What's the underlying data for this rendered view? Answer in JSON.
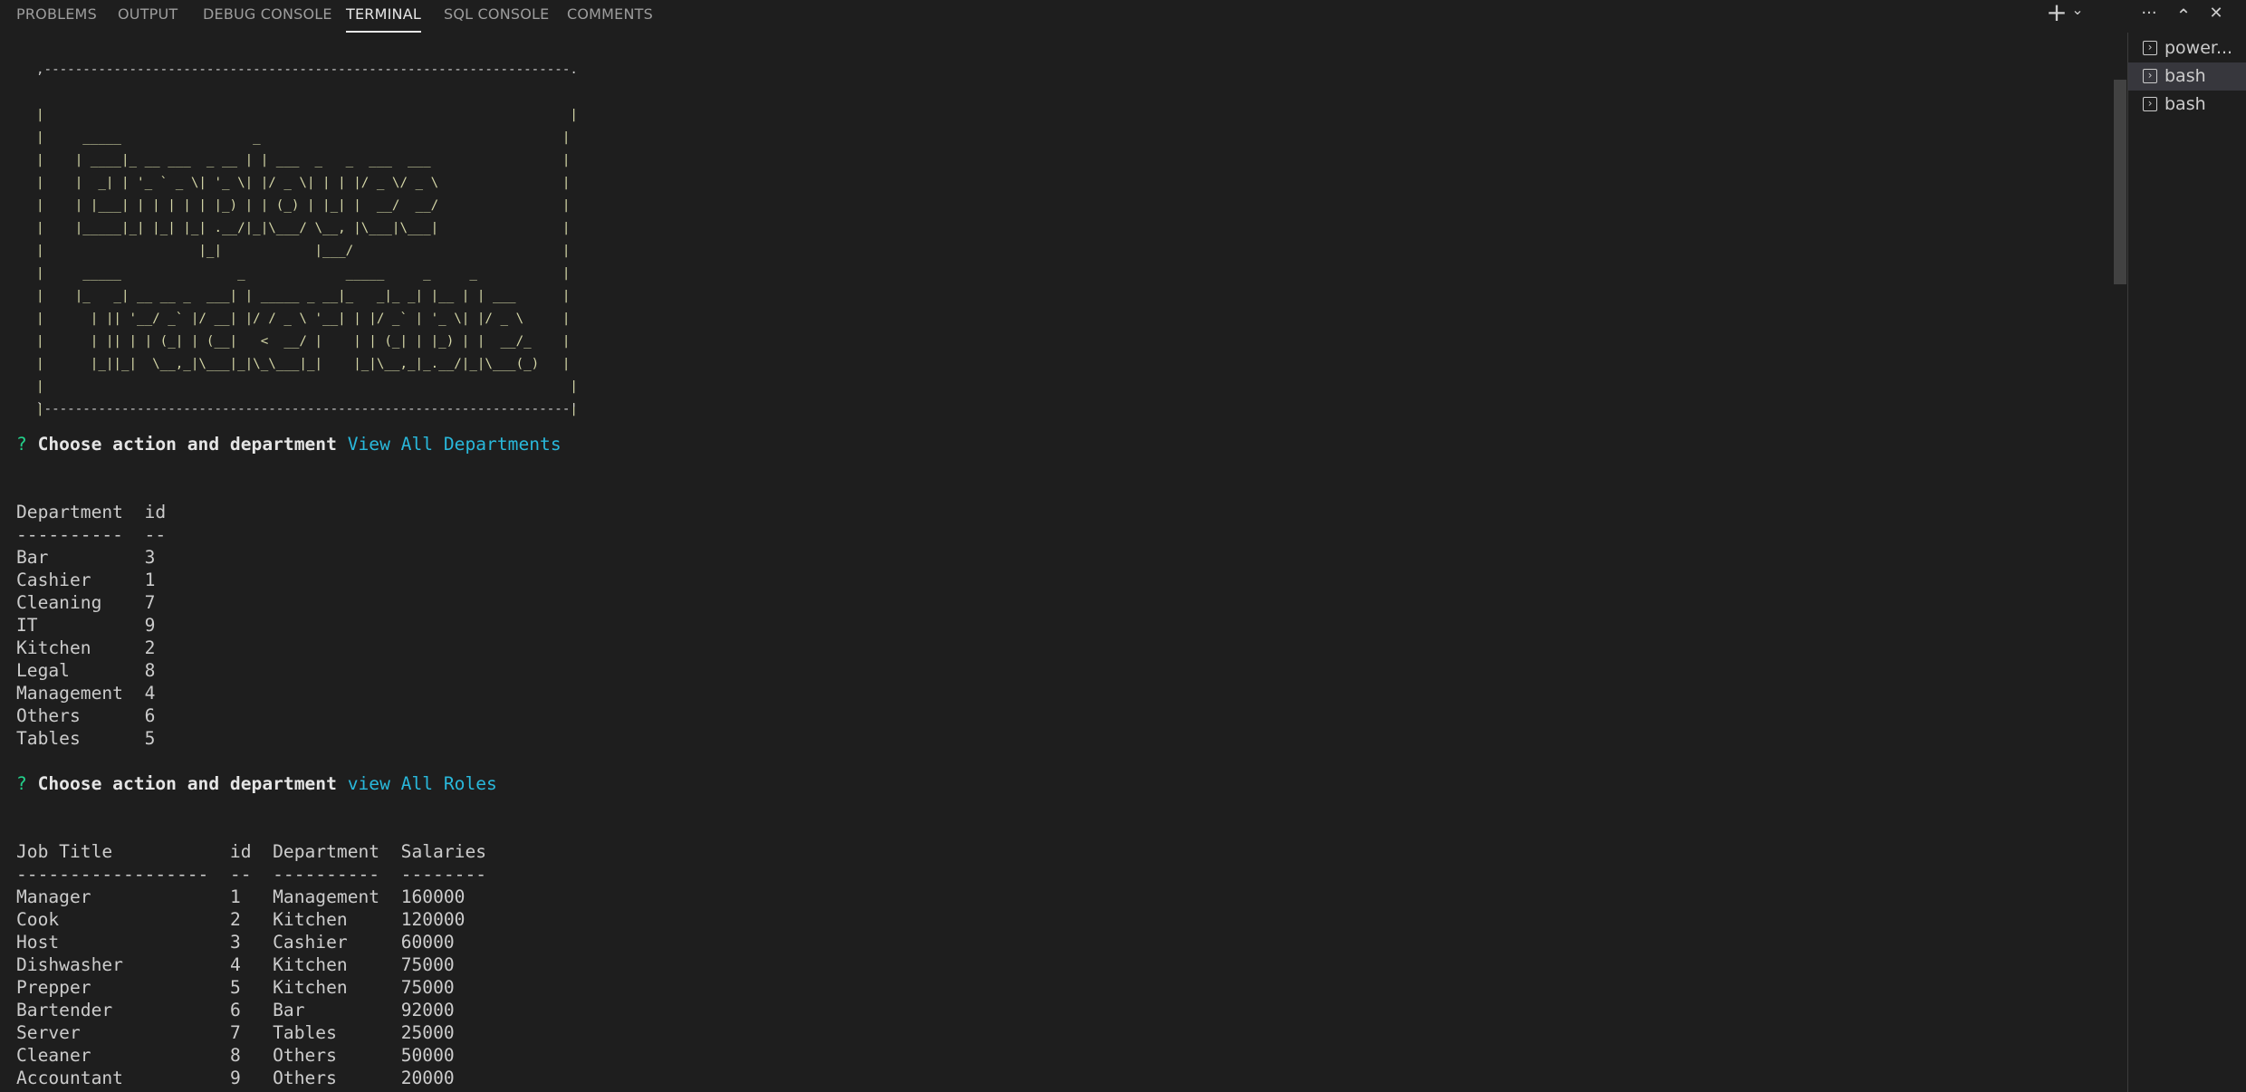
{
  "panel": {
    "tabs": [
      {
        "label": "PROBLEMS"
      },
      {
        "label": "OUTPUT"
      },
      {
        "label": "DEBUG CONSOLE"
      },
      {
        "label": "TERMINAL"
      },
      {
        "label": "SQL CONSOLE"
      },
      {
        "label": "COMMENTS"
      }
    ],
    "active_tab": "TERMINAL",
    "actions": {
      "new_terminal": "+",
      "dropdown": "⌄",
      "more": "···",
      "maximize": "⌃",
      "close": "✕"
    }
  },
  "terminals": [
    {
      "label": "power...",
      "icon": "terminal-icon"
    },
    {
      "label": "bash",
      "icon": "terminal-icon"
    },
    {
      "label": "bash",
      "icon": "terminal-icon"
    }
  ],
  "banner": {
    "top_border": ",--------------------------------------------------------------------.",
    "bottom_border": "`--------------------------------------------------------------------'",
    "art_lines": [
      "|                                                                    |",
      "|     _____                 _                                       |",
      "|    | ____|_ __ ___  _ __ | | ___  _   _  ___  ___                 |",
      "|    |  _| | '_ ` _ \\| '_ \\| |/ _ \\| | | |/ _ \\/ _ \\                |",
      "|    | |___| | | | | | |_) | | (_) | |_| |  __/  __/                |",
      "|    |_____|_| |_| |_| .__/|_|\\___/ \\__, |\\___|\\___|                |",
      "|                    |_|            |___/                           |",
      "|     _____               _             _____     _     _           |",
      "|    |_   _| __ __ _  ___| | _____ _ __|_   _|_ _| |__ | | ___      |",
      "|      | || '__/ _` |/ __| |/ / _ \\ '__| | |/ _` | '_ \\| |/ _ \\     |",
      "|      | || | | (_| | (__|   <  __/ |    | | (_| | |_) | |  __/_    |",
      "|      |_||_|  \\__,_|\\___|_|\\_\\___|_|    |_|\\__,_|_.__/|_|\\___(_)   |",
      "|                                                                    |",
      "|                                                                    |"
    ]
  },
  "prompt1": {
    "symbol": "?",
    "question": "Choose action and department",
    "answer": "View All Departments"
  },
  "departments_table": {
    "header": "Department  id",
    "separator": "----------  --",
    "rows": [
      {
        "name": "Bar",
        "id": "3"
      },
      {
        "name": "Cashier",
        "id": "1"
      },
      {
        "name": "Cleaning",
        "id": "7"
      },
      {
        "name": "IT",
        "id": "9"
      },
      {
        "name": "Kitchen",
        "id": "2"
      },
      {
        "name": "Legal",
        "id": "8"
      },
      {
        "name": "Management",
        "id": "4"
      },
      {
        "name": "Others",
        "id": "6"
      },
      {
        "name": "Tables",
        "id": "5"
      }
    ]
  },
  "prompt2": {
    "symbol": "?",
    "question": "Choose action and department",
    "answer": "view All Roles"
  },
  "roles_table": {
    "header": "Job Title           id  Department  Salaries",
    "separator": "------------------  --  ----------  --------",
    "rows": [
      {
        "title": "Manager",
        "id": "1",
        "department": "Management",
        "salary": "160000"
      },
      {
        "title": "Cook",
        "id": "2",
        "department": "Kitchen",
        "salary": "120000"
      },
      {
        "title": "Host",
        "id": "3",
        "department": "Cashier",
        "salary": "60000"
      },
      {
        "title": "Dishwasher",
        "id": "4",
        "department": "Kitchen",
        "salary": "75000"
      },
      {
        "title": "Prepper",
        "id": "5",
        "department": "Kitchen",
        "salary": "75000"
      },
      {
        "title": "Bartender",
        "id": "6",
        "department": "Bar",
        "salary": "92000"
      },
      {
        "title": "Server",
        "id": "7",
        "department": "Tables",
        "salary": "25000"
      },
      {
        "title": "Cleaner",
        "id": "8",
        "department": "Others",
        "salary": "50000"
      },
      {
        "title": "Accountant",
        "id": "9",
        "department": "Others",
        "salary": "20000"
      }
    ]
  },
  "colors": {
    "background": "#1e1e1e",
    "prompt_symbol": "#23d18b",
    "prompt_answer": "#29b8db",
    "banner_art": "#d6d8a8",
    "text": "#cccccc"
  }
}
